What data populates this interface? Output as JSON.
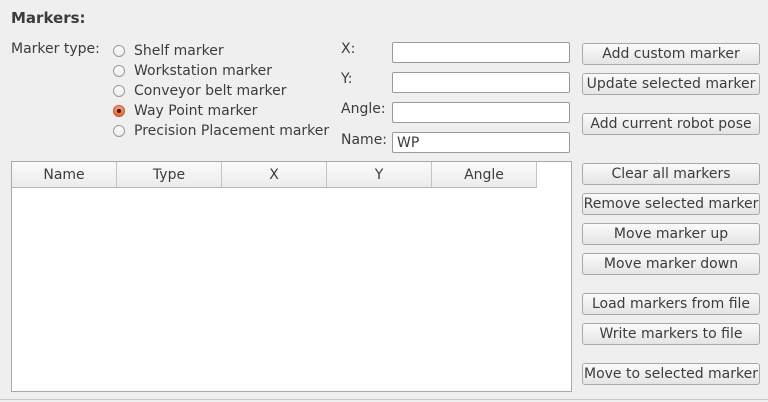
{
  "section_title": "Markers:",
  "marker_type_label": "Marker type:",
  "marker_types": [
    {
      "label": "Shelf marker",
      "checked": false
    },
    {
      "label": "Workstation marker",
      "checked": false
    },
    {
      "label": "Conveyor belt marker",
      "checked": false
    },
    {
      "label": "Way Point marker",
      "checked": true
    },
    {
      "label": "Precision Placement marker",
      "checked": false
    }
  ],
  "fields": {
    "x_label": "X:",
    "x_value": "",
    "y_label": "Y:",
    "y_value": "",
    "angle_label": "Angle:",
    "angle_value": "",
    "name_label": "Name:",
    "name_value": "WP"
  },
  "buttons": {
    "add_custom": "Add custom marker",
    "update_selected": "Update selected marker",
    "add_robot_pose": "Add current robot pose",
    "clear_all": "Clear all markers",
    "remove_selected": "Remove selected marker",
    "move_up": "Move marker up",
    "move_down": "Move marker down",
    "load_file": "Load markers from file",
    "write_file": "Write markers to file",
    "move_to_selected": "Move to selected marker"
  },
  "table": {
    "columns": [
      "Name",
      "Type",
      "X",
      "Y",
      "Angle"
    ],
    "rows": []
  },
  "colors": {
    "background": "#efefef",
    "radio_checked": "#e2683a"
  }
}
